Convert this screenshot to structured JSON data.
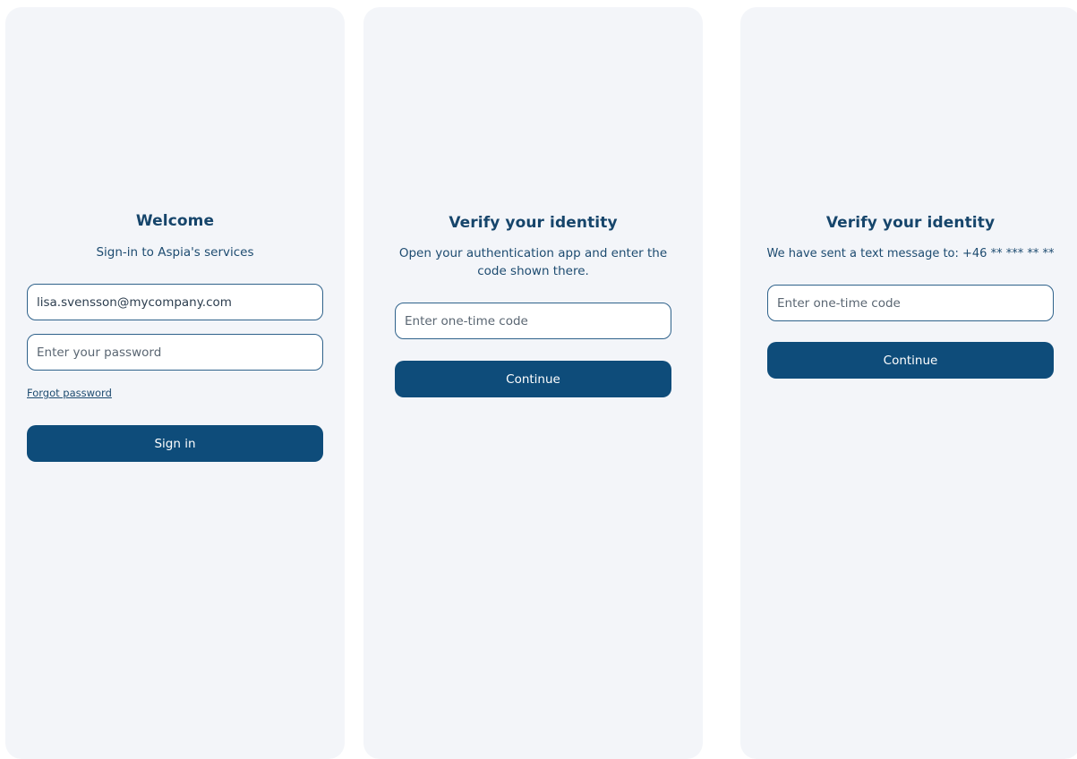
{
  "signin": {
    "title": "Welcome",
    "subtitle": "Sign-in to Aspia's services",
    "email_value": "lisa.svensson@mycompany.com",
    "password_placeholder": "Enter your password",
    "forgot_password_label": "Forgot password",
    "sign_in_label": "Sign in"
  },
  "verify_app": {
    "title": "Verify your identity",
    "instruction_line1": "Open your authentication app and enter the",
    "instruction_line2": "code shown there.",
    "code_placeholder": "Enter one-time code",
    "continue_label": "Continue"
  },
  "verify_sms": {
    "title": "Verify your identity",
    "instruction": "We have sent a text message to: +46 ** *** ** **",
    "code_placeholder": "Enter one-time code",
    "continue_label": "Continue"
  },
  "colors": {
    "screen_background": "#f3f5f9",
    "primary_button": "#0e4c7a",
    "heading_text": "#16456b",
    "field_border": "#2f628b"
  }
}
